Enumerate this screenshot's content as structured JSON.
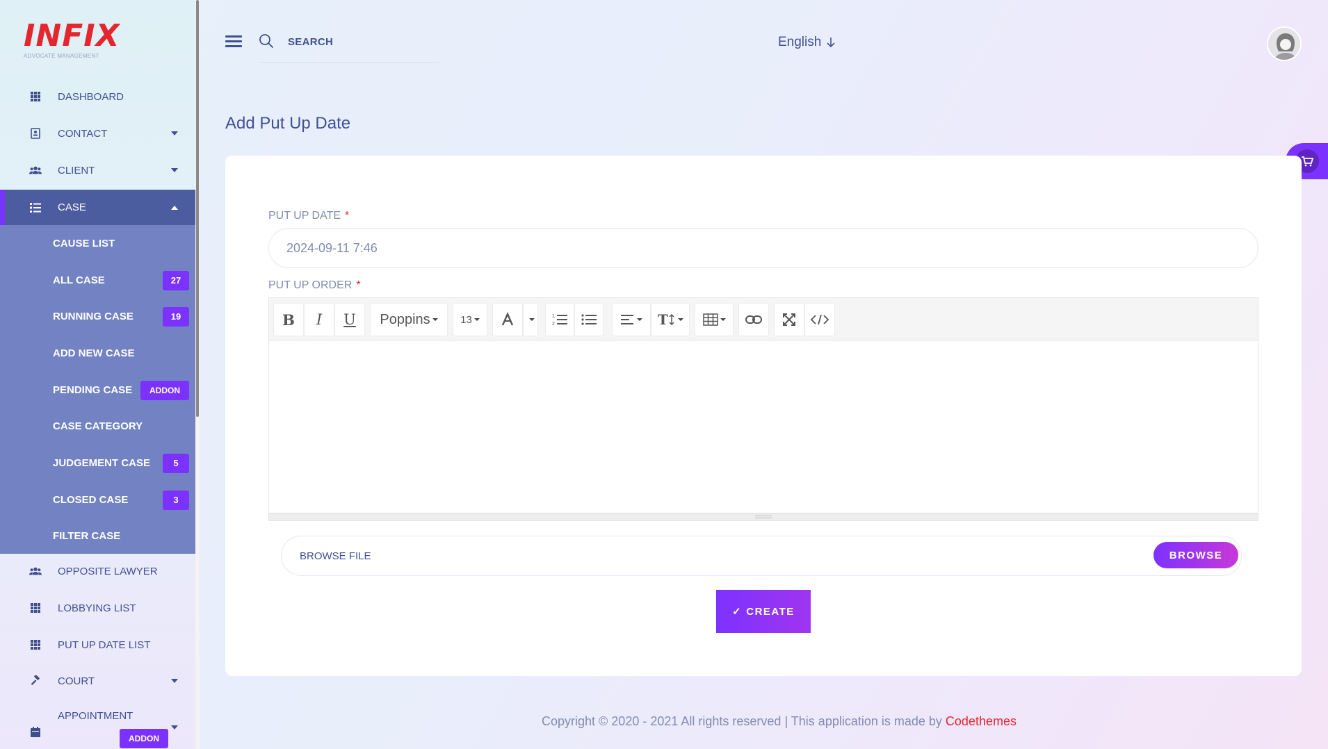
{
  "brand": {
    "logo_text": "INFIX",
    "logo_subtitle": "ADVOCATE MANAGEMENT",
    "logo_color": "#e5262f"
  },
  "sidebar": {
    "items": [
      {
        "label": "DASHBOARD",
        "icon": "grid-icon"
      },
      {
        "label": "CONTACT",
        "icon": "contact-book-icon"
      },
      {
        "label": "CLIENT",
        "icon": "users-icon"
      },
      {
        "label": "CASE",
        "icon": "list-icon"
      },
      {
        "label": "OPPOSITE LAWYER",
        "icon": "users-icon"
      },
      {
        "label": "LOBBYING LIST",
        "icon": "grid-icon"
      },
      {
        "label": "PUT UP DATE LIST",
        "icon": "grid-icon"
      },
      {
        "label": "COURT",
        "icon": "gavel-icon"
      },
      {
        "label": "APPOINTMENT",
        "icon": "calendar-icon"
      }
    ],
    "case_submenu": [
      {
        "label": "CAUSE LIST"
      },
      {
        "label": "ALL CASE",
        "badge": "27"
      },
      {
        "label": "RUNNING CASE",
        "badge": "19"
      },
      {
        "label": "ADD NEW CASE"
      },
      {
        "label": "PENDING CASE",
        "badge": "ADDON"
      },
      {
        "label": "CASE CATEGORY"
      },
      {
        "label": "JUDGEMENT CASE",
        "badge": "5"
      },
      {
        "label": "CLOSED CASE",
        "badge": "3"
      },
      {
        "label": "FILTER CASE"
      }
    ],
    "appointment_badge": "ADDON"
  },
  "header": {
    "search_placeholder": "SEARCH",
    "language": "English"
  },
  "page": {
    "title": "Add Put Up Date"
  },
  "form": {
    "put_up_date_label": "PUT UP DATE",
    "put_up_date_value": "2024-09-11 7:46",
    "put_up_order_label": "PUT UP ORDER",
    "required_mark": "*",
    "editor": {
      "font_family": "Poppins",
      "font_size": "13",
      "tools": [
        "bold",
        "italic",
        "underline",
        "font-family",
        "font-size",
        "font-color",
        "ordered-list",
        "unordered-list",
        "align",
        "text-height",
        "table",
        "link",
        "fullscreen",
        "code-view"
      ]
    },
    "file_label": "BROWSE FILE",
    "browse_button": "BROWSE",
    "create_button": "CREATE",
    "create_check": "✓"
  },
  "footer": {
    "text": "Copyright © 2020 - 2021 All rights reserved | This application is made by",
    "brand": "Codethemes"
  },
  "colors": {
    "accent": "#7c32ff",
    "sidebar_active": "#4b5d9f",
    "submenu_bg": "#7282c2",
    "text_primary": "#415094",
    "text_muted": "#828bb2"
  }
}
